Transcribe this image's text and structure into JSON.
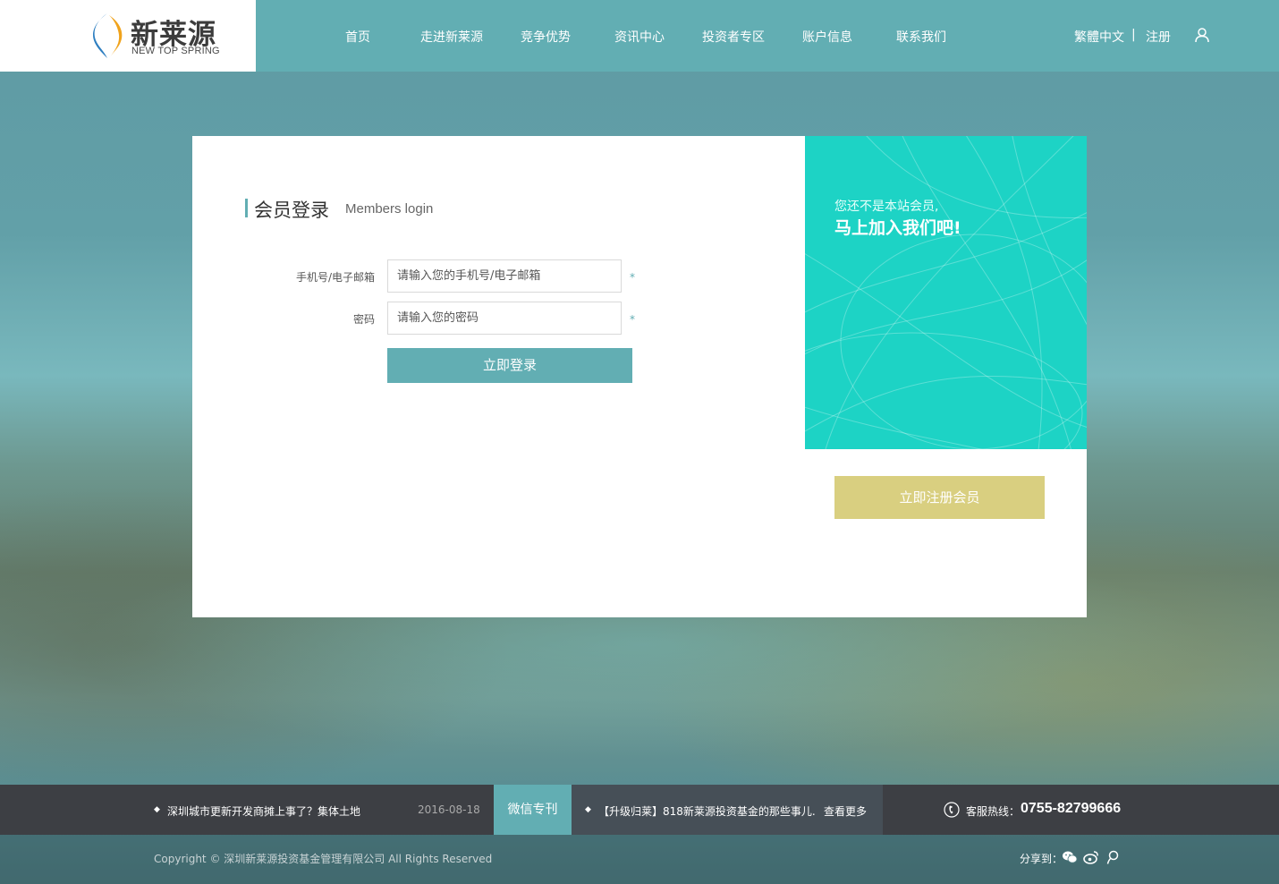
{
  "header": {
    "logo_cn": "新莱源",
    "logo_en": "NEW TOP SPRING",
    "nav": [
      "首页",
      "走进新莱源",
      "竞争优势",
      "资讯中心",
      "投资者专区",
      "账户信息",
      "联系我们"
    ],
    "lang_label": "繁體中文",
    "separator": "|",
    "register_label": "注册",
    "accent_color": "#62aeb3"
  },
  "login": {
    "title_cn": "会员登录",
    "title_en": "Members login",
    "account_label": "手机号/电子邮箱",
    "account_placeholder": "请输入您的手机号/电子邮箱",
    "password_label": "密码",
    "password_placeholder": "请输入您的密码",
    "required_mark": "*",
    "submit_label": "立即登录"
  },
  "promo": {
    "sub_text": "您还不是本站会员,",
    "main_text": "马上加入我们吧!",
    "bg_color": "#1dd3c5",
    "register_button": "立即注册会员",
    "register_color": "#d9cf80"
  },
  "news_bar": {
    "item1_bullet": "◆",
    "item1_text": "深圳城市更新开发商摊上事了？集体土地",
    "item1_date": "2016-08-18",
    "wechat_tag": "微信专刊",
    "item2_bullet": "◆",
    "item2_text": "【升级归莱】818新莱源投资基金的那些事儿...",
    "more_label": "查看更多",
    "hotline_label": "客服热线：",
    "hotline_number": "0755-82799666"
  },
  "footer": {
    "copyright": "Copyright © 深圳新莱源投资基金管理有限公司 All Rights Reserved",
    "share_label": "分享到：",
    "share_icons": [
      "wechat-icon",
      "weibo-icon",
      "tencent-weibo-icon"
    ]
  }
}
